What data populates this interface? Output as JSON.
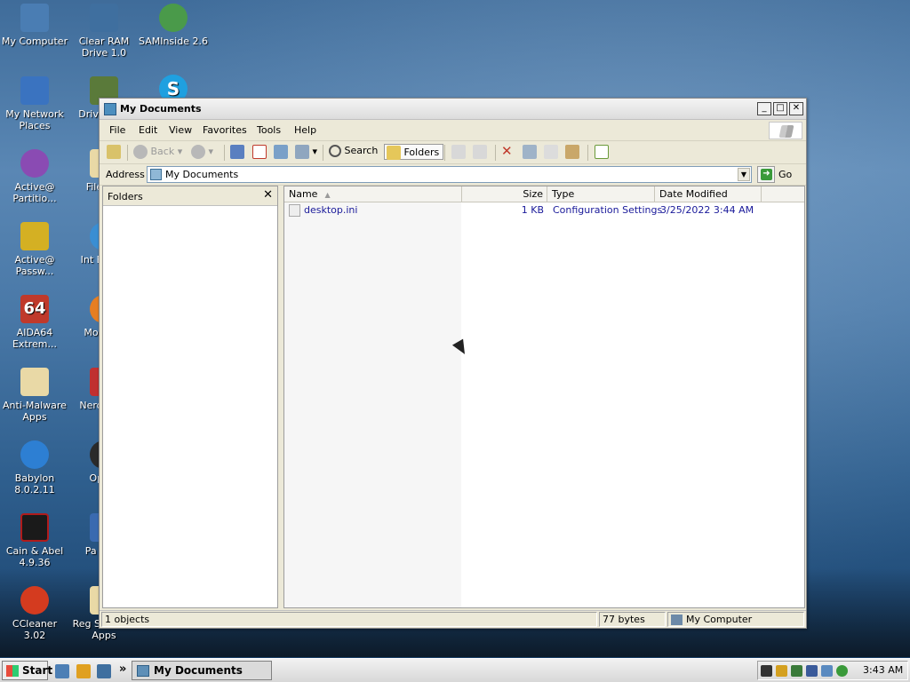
{
  "desktop": {
    "icons": [
      {
        "label": "My Computer",
        "icon": "my-computer-icon",
        "color": "#4a7db3"
      },
      {
        "label": "My Network Places",
        "icon": "network-places-icon",
        "color": "#3a73c0"
      },
      {
        "label": "Active@ Partitio...",
        "icon": "partition-icon",
        "color": "#8a4bb3"
      },
      {
        "label": "Active@ Passw...",
        "icon": "key-icon",
        "color": "#d4b023"
      },
      {
        "label": "AIDA64 Extrem...",
        "icon": "aida64-icon",
        "color": "#c0392b"
      },
      {
        "label": "Anti-Malware Apps",
        "icon": "folder-apps-icon",
        "color": "#e9d9a6"
      },
      {
        "label": "Babylon 8.0.2.11",
        "icon": "babylon-icon",
        "color": "#2d7fd3"
      },
      {
        "label": "Cain & Abel 4.9.36",
        "icon": "cain-icon",
        "color": "#b01b1b"
      },
      {
        "label": "CCleaner 3.02",
        "icon": "ccleaner-icon",
        "color": "#d43b1f"
      },
      {
        "label": "Clear RAM Drive 1.0",
        "icon": "clear-ram-icon",
        "color": "#3f6f9f"
      },
      {
        "label": "Drive PE V",
        "icon": "drive-icon",
        "color": "#5a7a3a"
      },
      {
        "label": "File R A",
        "icon": "folder-icon",
        "color": "#e9d9a6"
      },
      {
        "label": "Int Explor",
        "icon": "ie-icon",
        "color": "#3a8ed3"
      },
      {
        "label": "Mozill 3.",
        "icon": "firefox-icon",
        "color": "#e67e22"
      },
      {
        "label": "Nero ROM",
        "icon": "nero-icon",
        "color": "#c03030"
      },
      {
        "label": "Ope 3",
        "icon": "opera-icon",
        "color": "#2a2a2a"
      },
      {
        "label": "Pa Wiza",
        "icon": "wizard-icon",
        "color": "#3a6ab0"
      },
      {
        "label": "Reg Services Apps",
        "icon": "folder-apps-icon",
        "color": "#e9d9a6"
      },
      {
        "label": "SAMInside 2.6",
        "icon": "saminside-icon",
        "color": "#4a9a4a"
      },
      {
        "label": "",
        "icon": "skype-icon",
        "color": "#1fa0e0"
      }
    ]
  },
  "window": {
    "title": "My Documents",
    "menu": [
      "File",
      "Edit",
      "View",
      "Favorites",
      "Tools",
      "Help"
    ],
    "toolbar": {
      "back_label": "Back",
      "search_label": "Search",
      "folders_label": "Folders"
    },
    "address": {
      "label": "Address",
      "value": "My Documents",
      "go_label": "Go"
    },
    "folders_pane": {
      "title": "Folders",
      "close_label": "✕"
    },
    "columns": [
      "Name",
      "Size",
      "Type",
      "Date Modified"
    ],
    "files": [
      {
        "name": "desktop.ini",
        "size": "1 KB",
        "type": "Configuration Settings",
        "modified": "3/25/2022 3:44 AM"
      }
    ],
    "status": {
      "objects": "1 objects",
      "size": "77 bytes",
      "location": "My Computer"
    }
  },
  "taskbar": {
    "start_label": "Start",
    "task_label": "My Documents",
    "clock": "3:43 AM",
    "quicklaunch_more": "»"
  }
}
